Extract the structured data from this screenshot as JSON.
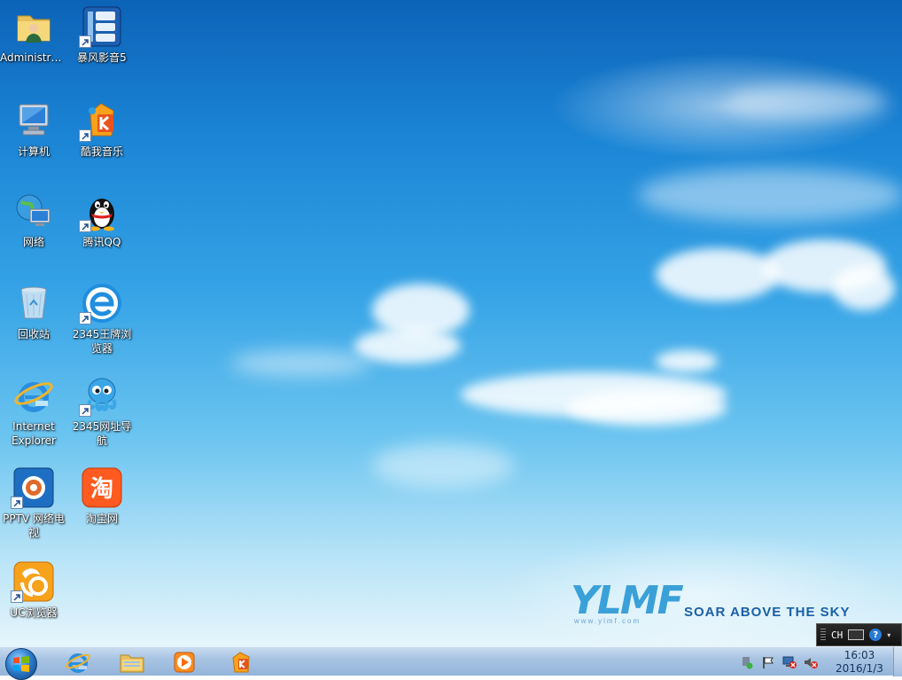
{
  "desktop": {
    "icons": [
      {
        "label": "Administra...",
        "icon": "user-folder-icon",
        "shortcut": false
      },
      {
        "label": "暴风影音5",
        "icon": "storm-player-icon",
        "shortcut": true
      },
      {
        "label": "计算机",
        "icon": "computer-icon",
        "shortcut": false
      },
      {
        "label": "酷我音乐",
        "icon": "kuwo-music-icon",
        "shortcut": true
      },
      {
        "label": "网络",
        "icon": "network-icon",
        "shortcut": false
      },
      {
        "label": "腾讯QQ",
        "icon": "qq-penguin-icon",
        "shortcut": true
      },
      {
        "label": "回收站",
        "icon": "recycle-bin-icon",
        "shortcut": false
      },
      {
        "label": "2345王牌浏览器",
        "icon": "browser-2345-icon",
        "shortcut": true
      },
      {
        "label": "Internet Explorer",
        "icon": "internet-explorer-icon",
        "shortcut": false
      },
      {
        "label": "2345网址导航",
        "icon": "octopus-nav-icon",
        "shortcut": true
      },
      {
        "label": "PPTV 网络电视",
        "icon": "pptv-icon",
        "shortcut": true
      },
      {
        "label": "淘宝网",
        "icon": "taobao-icon",
        "shortcut": false
      },
      {
        "label": "UC浏览器",
        "icon": "uc-browser-icon",
        "shortcut": true
      }
    ]
  },
  "branding": {
    "logo": "YLMF",
    "tagline": "SOAR ABOVE THE SKY",
    "url": "www.ylmf.com"
  },
  "langbar": {
    "code": "CH",
    "help": "?"
  },
  "taskbar": {
    "pinned": [
      {
        "icon": "internet-explorer-icon"
      },
      {
        "icon": "file-explorer-icon"
      },
      {
        "icon": "media-player-icon"
      },
      {
        "icon": "kuwo-music-icon"
      }
    ],
    "tray": [
      "action-center-flag-icon",
      "network-disconnected-icon",
      "volume-muted-icon"
    ],
    "clock": {
      "time": "16:03",
      "date": "2016/1/3"
    }
  },
  "colors": {
    "sky_top": "#0c63b8",
    "sky_bottom": "#e6f5fb",
    "taskbar": "#a8c4e3"
  }
}
